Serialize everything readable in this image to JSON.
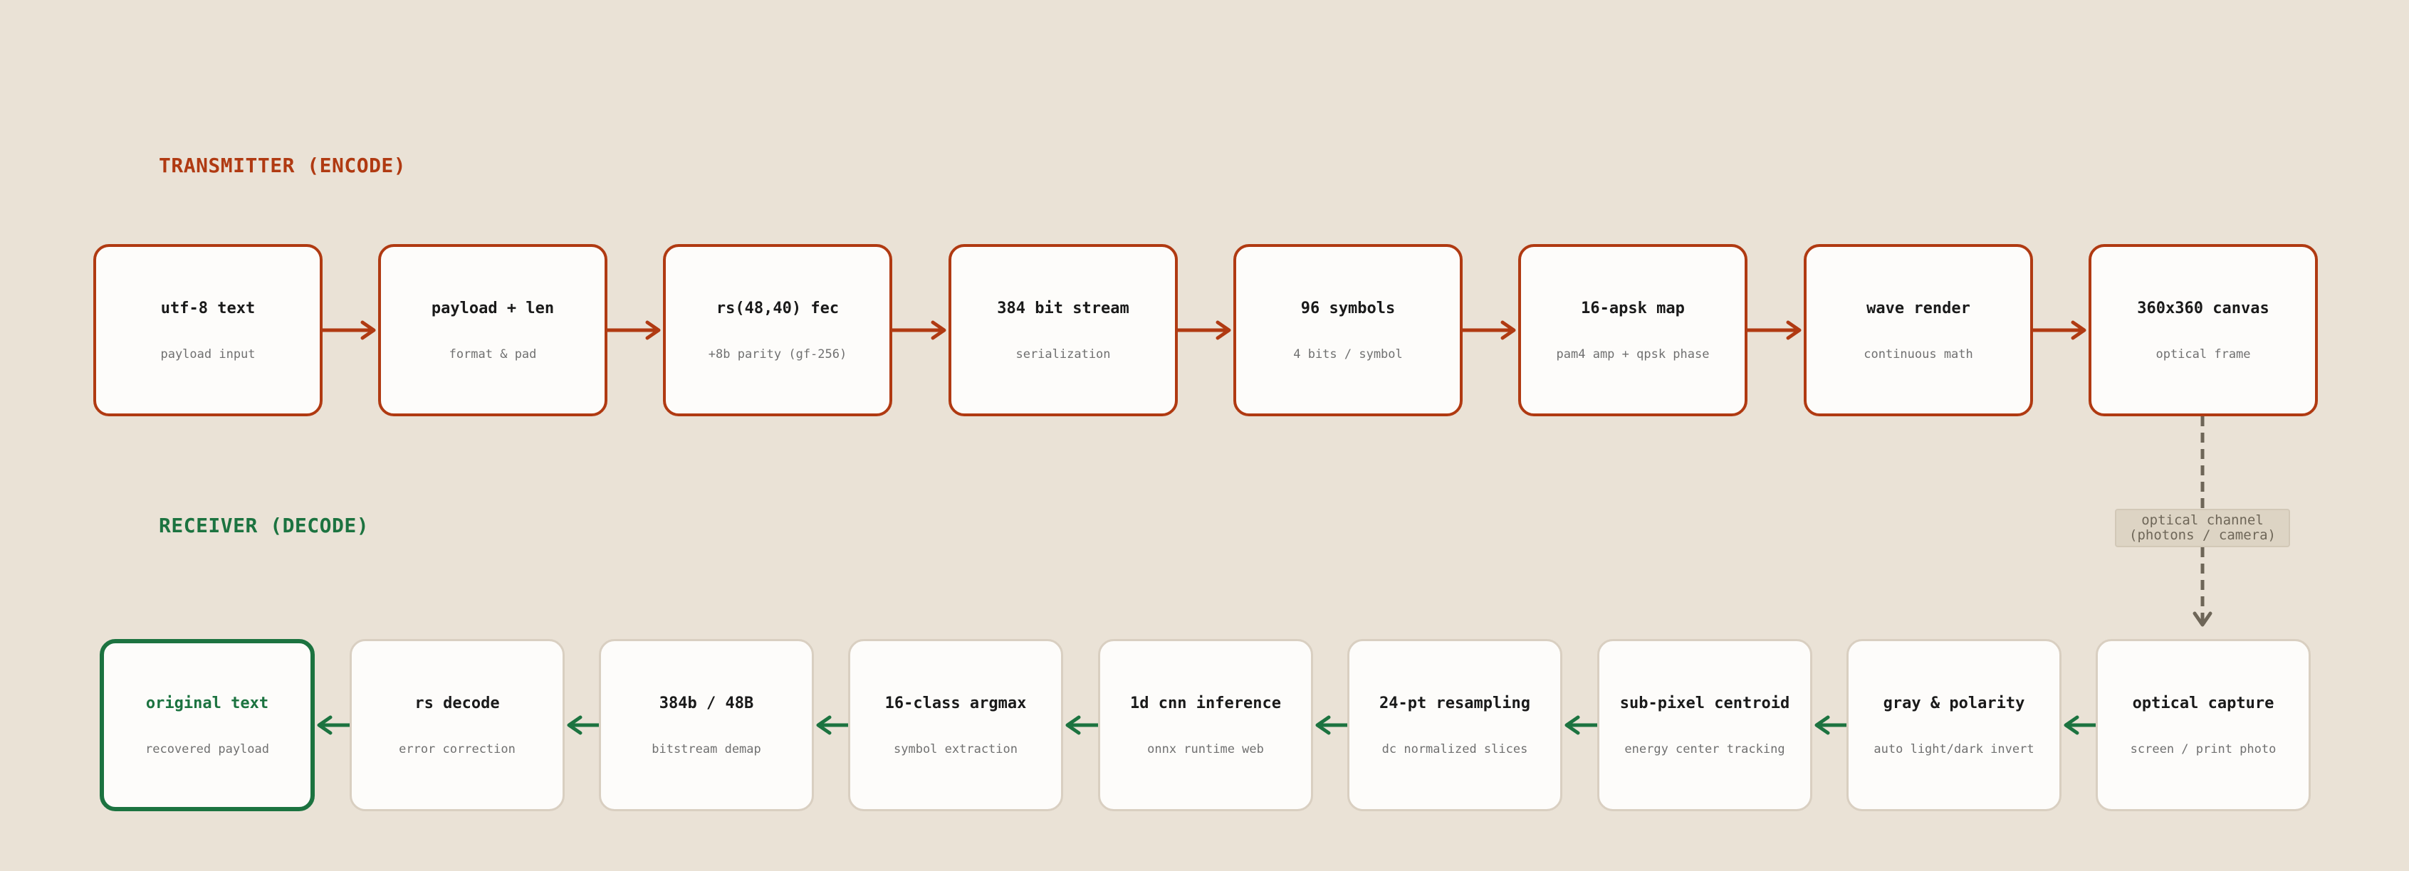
{
  "transmitter": {
    "title": "TRANSMITTER (ENCODE)",
    "color": "#b03a12",
    "nodes": [
      {
        "title": "utf-8 text",
        "subtitle": "payload input"
      },
      {
        "title": "payload + len",
        "subtitle": "format & pad"
      },
      {
        "title": "rs(48,40) fec",
        "subtitle": "+8b parity (gf-256)"
      },
      {
        "title": "384 bit stream",
        "subtitle": "serialization"
      },
      {
        "title": "96 symbols",
        "subtitle": "4 bits / symbol"
      },
      {
        "title": "16-apsk map",
        "subtitle": "pam4 amp + qpsk phase"
      },
      {
        "title": "wave render",
        "subtitle": "continuous math"
      },
      {
        "title": "360x360 canvas",
        "subtitle": "optical frame"
      }
    ]
  },
  "receiver": {
    "title": "RECEIVER (DECODE)",
    "color": "#1c7340",
    "nodes": [
      {
        "title": "original text",
        "subtitle": "recovered payload"
      },
      {
        "title": "rs decode",
        "subtitle": "error correction"
      },
      {
        "title": "384b / 48B",
        "subtitle": "bitstream demap"
      },
      {
        "title": "16-class argmax",
        "subtitle": "symbol extraction"
      },
      {
        "title": "1d cnn inference",
        "subtitle": "onnx runtime web"
      },
      {
        "title": "24-pt resampling",
        "subtitle": "dc normalized slices"
      },
      {
        "title": "sub-pixel centroid",
        "subtitle": "energy center tracking"
      },
      {
        "title": "gray & polarity",
        "subtitle": "auto light/dark invert"
      },
      {
        "title": "optical capture",
        "subtitle": "screen / print photo"
      }
    ]
  },
  "channel": {
    "line1": "optical channel",
    "line2": "(photons / camera)",
    "color": "#6e6658"
  }
}
